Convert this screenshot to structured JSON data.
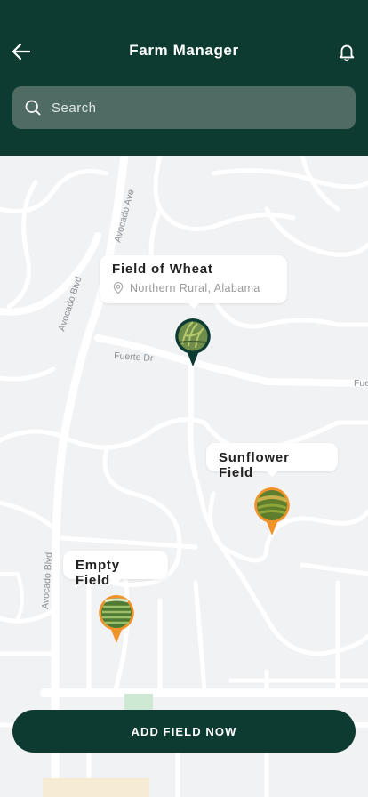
{
  "header": {
    "title": "Farm Manager",
    "back_icon": "arrow-left-icon",
    "bell_icon": "bell-icon"
  },
  "search": {
    "placeholder": "Search",
    "icon": "search-icon"
  },
  "map": {
    "streets": [
      "Avocado Ave",
      "Avocado Blvd",
      "Fuerte Dr",
      "Fue",
      "Avocado Blvd"
    ],
    "fields": [
      {
        "name": "Field of Wheat",
        "location": "Northern Rural, Alabama",
        "marker_color": "#0d3b32",
        "selected": true
      },
      {
        "name": "Sunflower Field",
        "marker_color": "#f0932b"
      },
      {
        "name": "Empty Field",
        "marker_color": "#f0932b"
      }
    ]
  },
  "actions": {
    "add_field": "ADD FIELD NOW"
  },
  "colors": {
    "primary": "#0d3b32",
    "accent": "#f0932b",
    "map_bg": "#f1f2f4",
    "road": "#ffffff"
  }
}
